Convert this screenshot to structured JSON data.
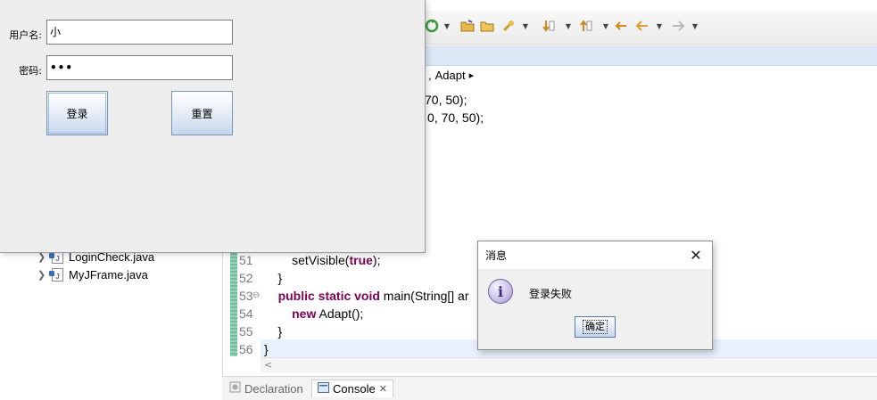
{
  "login_window": {
    "username_label": "用户名:",
    "username_value": "小",
    "password_label": "密码:",
    "password_value": "•••",
    "login_button": "登录",
    "reset_button": "重置"
  },
  "dialog": {
    "title": "消息",
    "close_glyph": "✕",
    "info_glyph": "i",
    "message": "登录失败",
    "ok_button": "确定"
  },
  "eclipse": {
    "breadcrumb": {
      "separator": ",",
      "item": "Adapt",
      "arrow": "▸"
    },
    "code_partial": [
      {
        "text": "70, 50);"
      },
      {
        "text": "0, 70, 50);"
      }
    ],
    "line_numbers": [
      "51",
      "52",
      "53",
      "54",
      "55",
      "56"
    ],
    "fold_marker": "⊖",
    "code_lines": [
      {
        "pre": "        setVisible(",
        "kw": "true",
        "post": ");"
      },
      {
        "pre": "    }",
        "kw": "",
        "post": ""
      },
      {
        "pre": "    ",
        "kw": "public static void",
        "post": " main(String[] ar"
      },
      {
        "pre": "        ",
        "kw": "new",
        "post": " Adapt();"
      },
      {
        "pre": "    }",
        "kw": "",
        "post": ""
      },
      {
        "pre": "}",
        "kw": "",
        "post": ""
      }
    ],
    "package_explorer": [
      {
        "name": "LoginCheck.java"
      },
      {
        "name": "MyJFrame.java"
      }
    ],
    "bottom_tabs": [
      {
        "label": "Declaration"
      },
      {
        "label": "Console",
        "close": "✕"
      }
    ]
  },
  "colors": {
    "keyword": "#7f0055",
    "button_gradient_bottom": "#c4d6ec",
    "breadcrumb_bar": "#dbe7f5"
  }
}
